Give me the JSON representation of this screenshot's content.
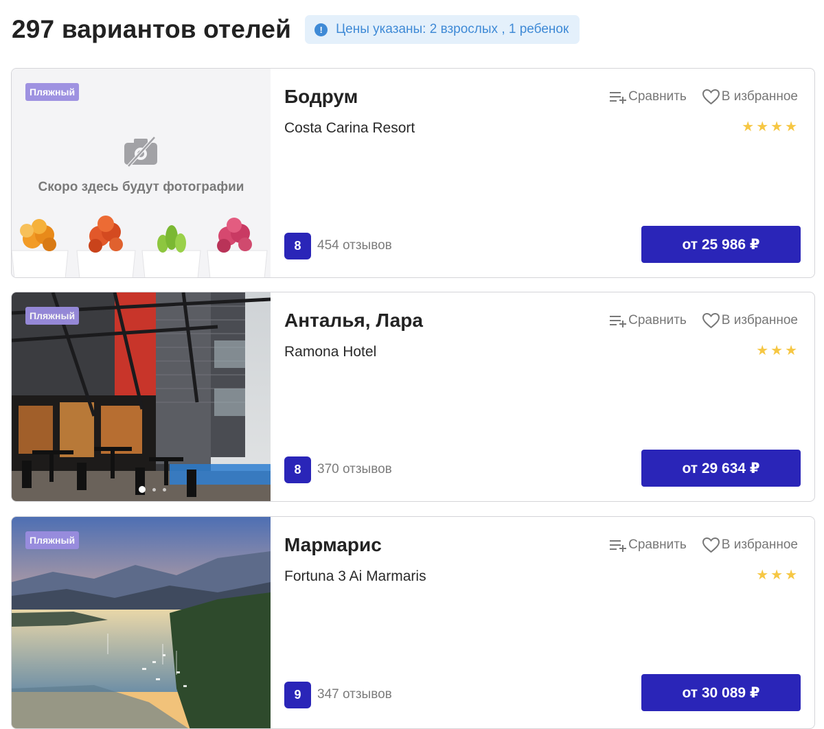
{
  "header": {
    "title": "297 вариантов отелей",
    "price_note": "Цены указаны: 2 взрослых , 1 ребенок",
    "info_icon": "!"
  },
  "colors": {
    "accent": "#2a25b8",
    "tag": "#9a8de0",
    "star": "#f6c744",
    "note_bg": "#e4f0fb",
    "note_text": "#3f8ad6"
  },
  "actions": {
    "compare_label": "Сравнить",
    "favorite_label": "В избранное"
  },
  "hotels": [
    {
      "tag": "Пляжный",
      "city": "Бодрум",
      "name": "Costa Carina Resort",
      "stars": "★★★★",
      "rating": "8",
      "reviews": "454 отзывов",
      "price": "от 25 986 ₽",
      "photo_placeholder": "Скоро здесь будут фотографии"
    },
    {
      "tag": "Пляжный",
      "city": "Анталья, Лара",
      "name": "Ramona Hotel",
      "stars": "★★★",
      "rating": "8",
      "reviews": "370 отзывов",
      "price": "от 29 634 ₽"
    },
    {
      "tag": "Пляжный",
      "city": "Мармарис",
      "name": "Fortuna 3 Ai Marmaris",
      "stars": "★★★",
      "rating": "9",
      "reviews": "347 отзывов",
      "price": "от 30 089 ₽"
    }
  ]
}
